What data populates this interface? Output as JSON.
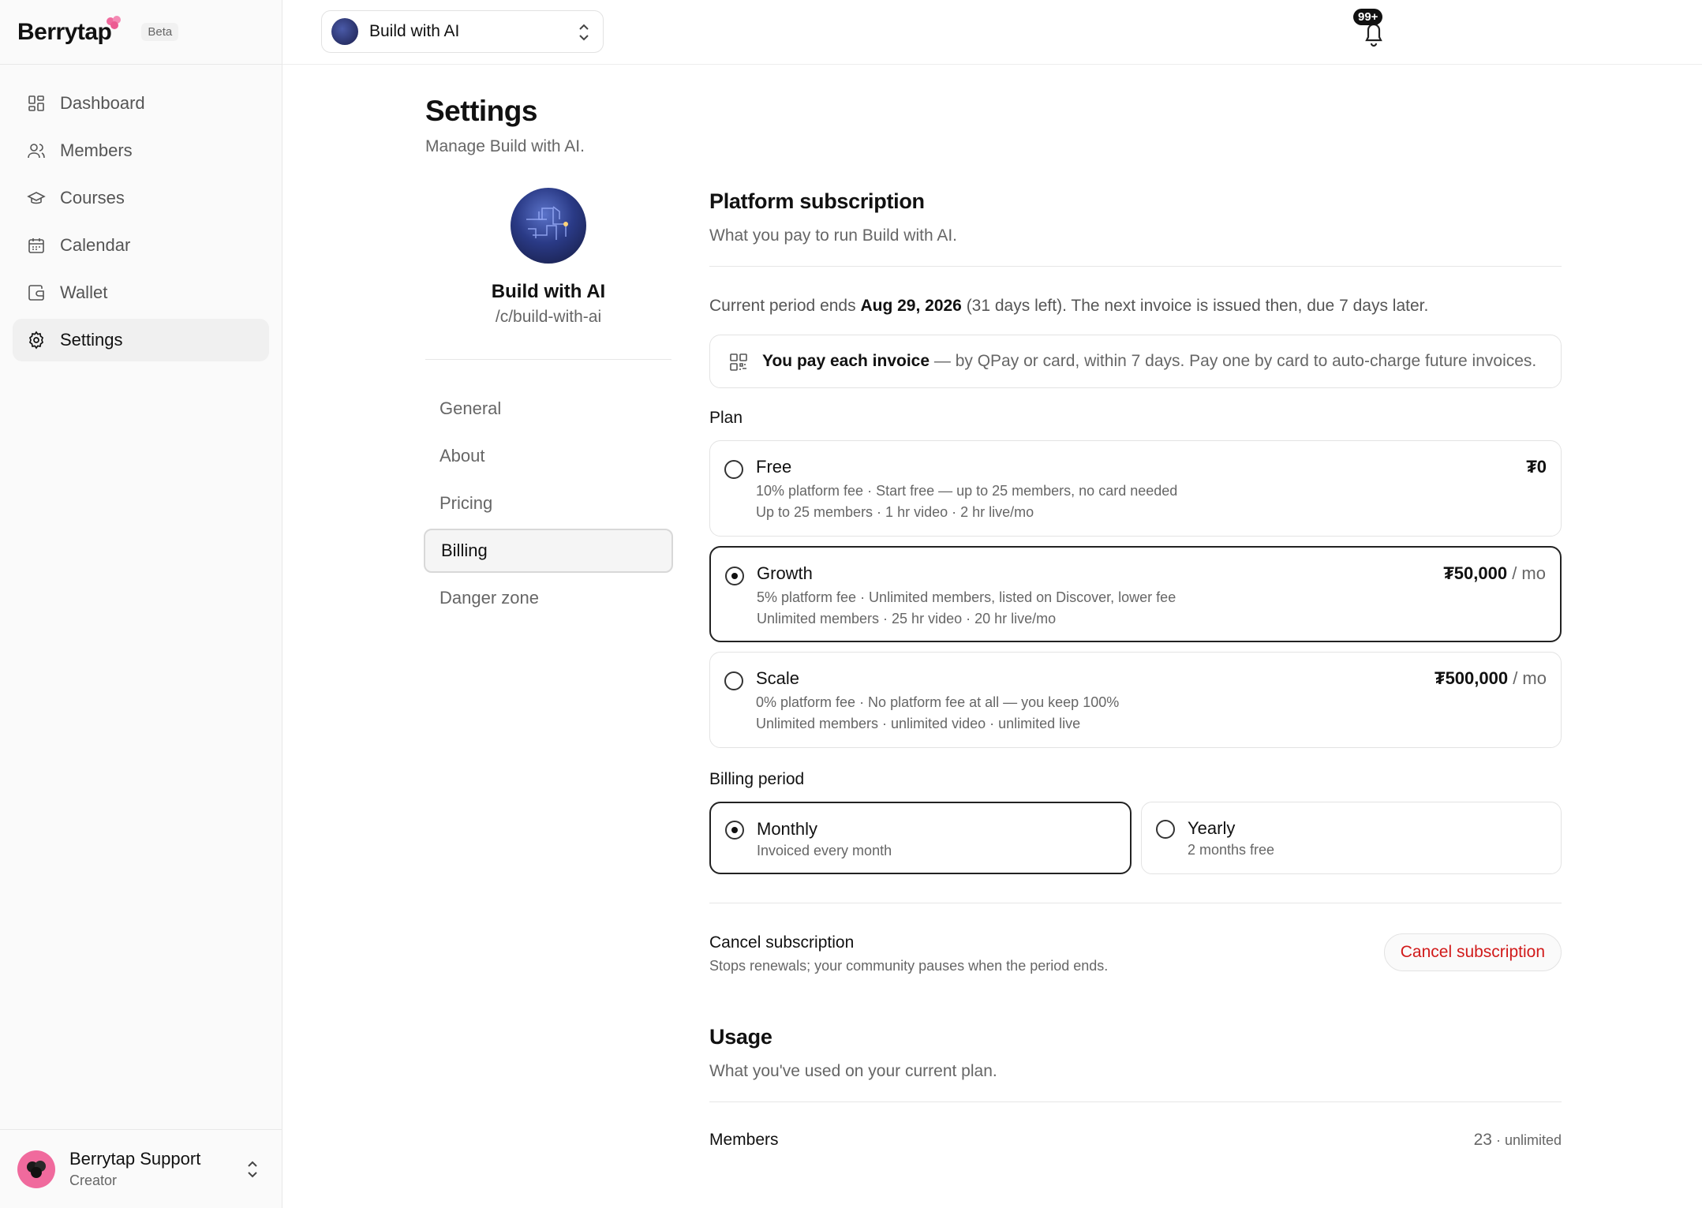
{
  "app": {
    "brand": "Berrytap",
    "beta_label": "Beta"
  },
  "sidebar": {
    "items": [
      {
        "label": "Dashboard",
        "icon": "dashboard-icon"
      },
      {
        "label": "Members",
        "icon": "users-icon"
      },
      {
        "label": "Courses",
        "icon": "graduation-cap-icon"
      },
      {
        "label": "Calendar",
        "icon": "calendar-icon"
      },
      {
        "label": "Wallet",
        "icon": "wallet-icon"
      },
      {
        "label": "Settings",
        "icon": "gear-icon",
        "active": true
      }
    ],
    "user": {
      "name": "Berrytap Support",
      "role": "Creator"
    }
  },
  "topbar": {
    "workspace_name": "Build with AI",
    "notification_badge": "99+"
  },
  "page": {
    "title": "Settings",
    "subtitle": "Manage Build with AI."
  },
  "community": {
    "name": "Build with AI",
    "slug": "/c/build-with-ai"
  },
  "subnav": {
    "items": [
      {
        "label": "General"
      },
      {
        "label": "About"
      },
      {
        "label": "Pricing"
      },
      {
        "label": "Billing",
        "active": true
      },
      {
        "label": "Danger zone"
      }
    ]
  },
  "subscription": {
    "title": "Platform subscription",
    "subtitle": "What you pay to run Build with AI.",
    "period_prefix": "Current period ends ",
    "period_date": "Aug 29, 2026",
    "period_suffix": " (31 days left). The next invoice is issued then, due 7 days later.",
    "notice_bold": "You pay each invoice",
    "notice_text": " — by QPay or card, within 7 days. Pay one by card to auto-charge future invoices."
  },
  "plan": {
    "label": "Plan",
    "options": [
      {
        "name": "Free",
        "fee": "10% platform fee · Start free — up to 25 members, no card needed",
        "limits": "Up to 25 members · 1 hr video · 2 hr live/mo",
        "price": "₮0",
        "per": "",
        "selected": false
      },
      {
        "name": "Growth",
        "fee": "5% platform fee · Unlimited members, listed on Discover, lower fee",
        "limits": "Unlimited members · 25 hr video · 20 hr live/mo",
        "price": "₮50,000",
        "per": " / mo",
        "selected": true
      },
      {
        "name": "Scale",
        "fee": "0% platform fee · No platform fee at all — you keep 100%",
        "limits": "Unlimited members · unlimited video · unlimited live",
        "price": "₮500,000",
        "per": " / mo",
        "selected": false
      }
    ]
  },
  "billing_period": {
    "label": "Billing period",
    "options": [
      {
        "name": "Monthly",
        "desc": "Invoiced every month",
        "selected": true
      },
      {
        "name": "Yearly",
        "desc": "2 months free",
        "selected": false
      }
    ]
  },
  "cancel": {
    "title": "Cancel subscription",
    "desc": "Stops renewals; your community pauses when the period ends.",
    "button": "Cancel subscription"
  },
  "usage": {
    "title": "Usage",
    "subtitle": "What you've used on your current plan.",
    "rows": [
      {
        "label": "Members",
        "value": "23",
        "limit": " · unlimited"
      }
    ]
  },
  "colors": {
    "danger": "#d11a1a",
    "avatar_pink": "#f06a9d",
    "brand_berry": "#f06a9d"
  }
}
